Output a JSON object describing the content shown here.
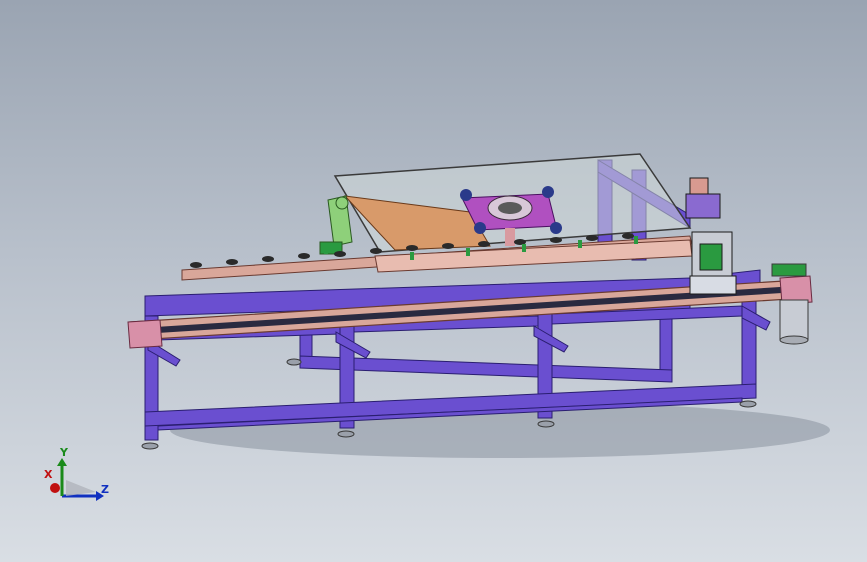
{
  "triad": {
    "x_label": "X",
    "y_label": "Y",
    "z_label": "Z"
  },
  "colors": {
    "background_top": "#9aa4b2",
    "background_bottom": "#d9dee4",
    "frame": "#6a4fd0",
    "conveyor_belt": "#d9a79a",
    "glass": "#cfd8d8",
    "ramp": "#d89a6a",
    "lift_arm": "#8ed07a",
    "clamp": "#b050c0",
    "motor": "#c8ccd4",
    "green_accent": "#2a9a40"
  }
}
